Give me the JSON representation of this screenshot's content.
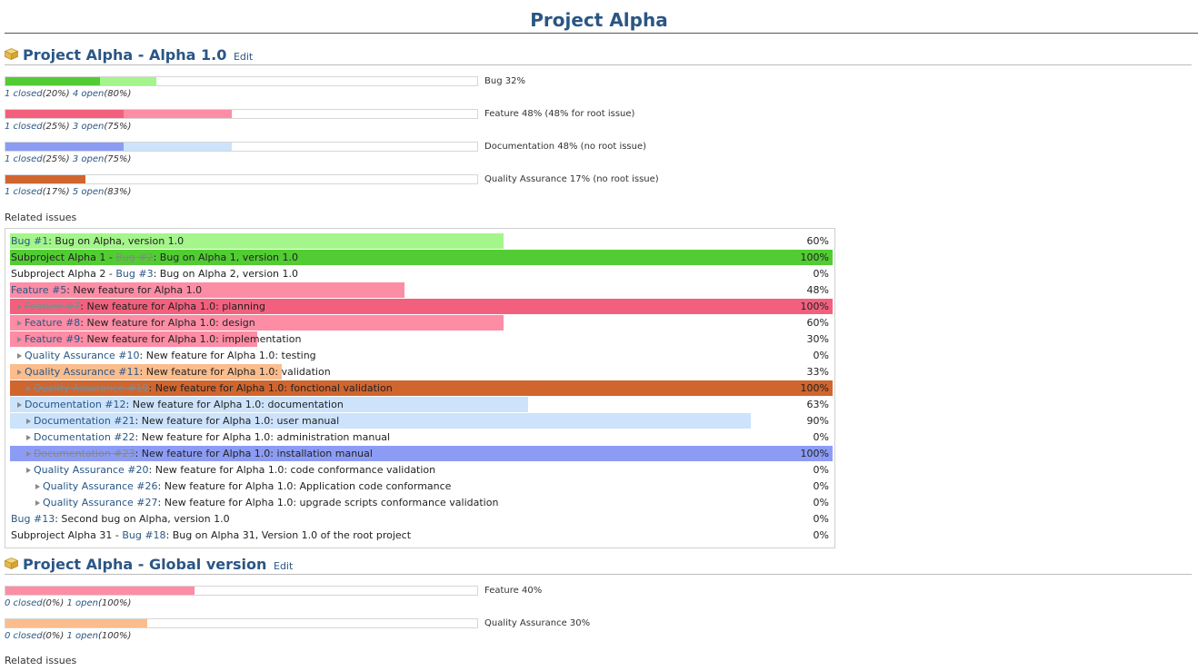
{
  "page_title": "Project Alpha",
  "colors": {
    "bug_done": "#52CC33",
    "bug_started": "#A4F58B",
    "feature_done": "#F3607D",
    "feature_started": "#FD8CA5",
    "doc_done": "#8C9CF5",
    "doc_started": "#CCE3FB",
    "qa_done": "#D0652E",
    "qa_started": "#FBBD8D"
  },
  "versions": [
    {
      "name": "Project Alpha - Alpha 1.0",
      "edit": "Edit",
      "trackers": [
        {
          "label": "Bug 32%",
          "closed": "1 closed",
          "closed_pct": "(20%)",
          "open": "4 open",
          "open_pct": "(80%)",
          "closed_ratio": 0.2,
          "done_ratio": 0.32
        },
        {
          "label": "Feature 48% (48% for root issue)",
          "closed": "1 closed",
          "closed_pct": "(25%)",
          "open": "3 open",
          "open_pct": "(75%)",
          "closed_ratio": 0.25,
          "done_ratio": 0.48
        },
        {
          "label": "Documentation 48% (no root issue)",
          "closed": "1 closed",
          "closed_pct": "(25%)",
          "open": "3 open",
          "open_pct": "(75%)",
          "closed_ratio": 0.25,
          "done_ratio": 0.48
        },
        {
          "label": "Quality Assurance 17% (no root issue)",
          "closed": "1 closed",
          "closed_pct": "(17%)",
          "open": "5 open",
          "open_pct": "(83%)",
          "closed_ratio": 0.17,
          "done_ratio": 0.17
        }
      ],
      "related_label": "Related issues",
      "issues": [
        {
          "prefix": "",
          "link": "Bug #1",
          "subject": ": Bug on Alpha, version 1.0",
          "pct": "60%",
          "done": 0.6,
          "kind": "bug",
          "closed": false,
          "level": 0,
          "arrow": false
        },
        {
          "prefix": "Subproject Alpha 1 - ",
          "link": "Bug #2",
          "subject": ": Bug on Alpha 1, version 1.0",
          "pct": "100%",
          "done": 1.0,
          "kind": "bug",
          "closed": true,
          "level": 0,
          "arrow": false
        },
        {
          "prefix": "Subproject Alpha 2 - ",
          "link": "Bug #3",
          "subject": ": Bug on Alpha 2, version 1.0",
          "pct": "0%",
          "done": 0,
          "kind": "bug",
          "closed": false,
          "level": 0,
          "arrow": false
        },
        {
          "prefix": "",
          "link": "Feature #5",
          "subject": ": New feature for Alpha 1.0",
          "pct": "48%",
          "done": 0.48,
          "kind": "feature",
          "closed": false,
          "level": 0,
          "arrow": false
        },
        {
          "prefix": "",
          "link": "Feature #7",
          "subject": ": New feature for Alpha 1.0: planning",
          "pct": "100%",
          "done": 1.0,
          "kind": "feature",
          "closed": true,
          "level": 1,
          "arrow": true
        },
        {
          "prefix": "",
          "link": "Feature #8",
          "subject": ": New feature for Alpha 1.0: design",
          "pct": "60%",
          "done": 0.6,
          "kind": "feature",
          "closed": false,
          "level": 1,
          "arrow": true
        },
        {
          "prefix": "",
          "link": "Feature #9",
          "subject": ": New feature for Alpha 1.0: implementation",
          "pct": "30%",
          "done": 0.3,
          "kind": "feature",
          "closed": false,
          "level": 1,
          "arrow": true
        },
        {
          "prefix": "",
          "link": "Quality Assurance #10",
          "subject": ": New feature for Alpha 1.0: testing",
          "pct": "0%",
          "done": 0,
          "kind": "qa",
          "closed": false,
          "level": 1,
          "arrow": true
        },
        {
          "prefix": "",
          "link": "Quality Assurance #11",
          "subject": ": New feature for Alpha 1.0: validation",
          "pct": "33%",
          "done": 0.33,
          "kind": "qa",
          "closed": false,
          "level": 1,
          "arrow": true
        },
        {
          "prefix": "",
          "link": "Quality Assurance #19",
          "subject": ": New feature for Alpha 1.0: fonctional validation",
          "pct": "100%",
          "done": 1.0,
          "kind": "qa",
          "closed": true,
          "level": 2,
          "arrow": true
        },
        {
          "prefix": "",
          "link": "Documentation #12",
          "subject": ": New feature for Alpha 1.0: documentation",
          "pct": "63%",
          "done": 0.63,
          "kind": "doc",
          "closed": false,
          "level": 1,
          "arrow": true
        },
        {
          "prefix": "",
          "link": "Documentation #21",
          "subject": ": New feature for Alpha 1.0: user manual",
          "pct": "90%",
          "done": 0.9,
          "kind": "doc",
          "closed": false,
          "level": 2,
          "arrow": true
        },
        {
          "prefix": "",
          "link": "Documentation #22",
          "subject": ": New feature for Alpha 1.0: administration manual",
          "pct": "0%",
          "done": 0,
          "kind": "doc",
          "closed": false,
          "level": 2,
          "arrow": true
        },
        {
          "prefix": "",
          "link": "Documentation #23",
          "subject": ": New feature for Alpha 1.0: installation manual",
          "pct": "100%",
          "done": 1.0,
          "kind": "doc",
          "closed": true,
          "level": 2,
          "arrow": true
        },
        {
          "prefix": "",
          "link": "Quality Assurance #20",
          "subject": ": New feature for Alpha 1.0: code conformance validation",
          "pct": "0%",
          "done": 0,
          "kind": "qa",
          "closed": false,
          "level": 2,
          "arrow": true
        },
        {
          "prefix": "",
          "link": "Quality Assurance #26",
          "subject": ": New feature for Alpha 1.0: Application code conformance",
          "pct": "0%",
          "done": 0,
          "kind": "qa",
          "closed": false,
          "level": 3,
          "arrow": true
        },
        {
          "prefix": "",
          "link": "Quality Assurance #27",
          "subject": ": New feature for Alpha 1.0: upgrade scripts conformance validation",
          "pct": "0%",
          "done": 0,
          "kind": "qa",
          "closed": false,
          "level": 3,
          "arrow": true
        },
        {
          "prefix": "",
          "link": "Bug #13",
          "subject": ": Second bug on Alpha, version 1.0",
          "pct": "0%",
          "done": 0,
          "kind": "bug",
          "closed": false,
          "level": 0,
          "arrow": false
        },
        {
          "prefix": "Subproject Alpha 31 - ",
          "link": "Bug #18",
          "subject": ": Bug on Alpha 31, Version 1.0 of the root project",
          "pct": "0%",
          "done": 0,
          "kind": "bug",
          "closed": false,
          "level": 0,
          "arrow": false
        }
      ]
    },
    {
      "name": "Project Alpha - Global version",
      "edit": "Edit",
      "trackers": [
        {
          "label": "Feature 40%",
          "closed": "0 closed",
          "closed_pct": "(0%)",
          "open": "1 open",
          "open_pct": "(100%)",
          "closed_ratio": 0,
          "done_ratio": 0.4
        },
        {
          "label": "Quality Assurance 30%",
          "closed": "0 closed",
          "closed_pct": "(0%)",
          "open": "1 open",
          "open_pct": "(100%)",
          "closed_ratio": 0,
          "done_ratio": 0.3
        }
      ],
      "related_label": "Related issues"
    }
  ]
}
